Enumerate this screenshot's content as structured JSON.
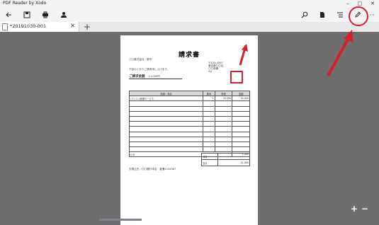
{
  "window": {
    "title": "PDF Reader by Xodo",
    "minimize": "–",
    "maximize": "□",
    "close": "✕"
  },
  "toolbar": {
    "back": "back-arrow-icon",
    "save": "save-icon",
    "print": "print-icon",
    "share": "person-icon",
    "search": "search-icon",
    "bookmarks": "document-icon",
    "outline": "list-icon",
    "edit": "pencil-icon",
    "more": "···"
  },
  "tabs": [
    {
      "label": "*20191030-001",
      "close": "✕"
    }
  ],
  "add_tab": "+",
  "document": {
    "title": "請求書",
    "recipient": "〇〇株式会社　御中",
    "greeting": "下記のとおりご請求申し上げます。",
    "total_label": "ご請求金額",
    "total_value": "11,000円",
    "sender_lines": [
      "〒123-4567",
      "東京都〇〇区",
      "〇〇商事",
      "XX"
    ],
    "headers": [
      "品番・品名",
      "数量",
      "単価",
      "金額"
    ],
    "rows": [
      [
        "パソコン修理サービス",
        "1",
        "10,000",
        "10,000"
      ]
    ],
    "subtotal_label": "小計",
    "subtotal_value": "1,000",
    "tax_label": "消費",
    "sum_label": "合計",
    "sum_value": "11,000",
    "bank": "お振込先：〇〇銀行本店　普通1234567"
  },
  "zoom": {
    "in": "+",
    "out": "−"
  },
  "accent": "#d81e28"
}
